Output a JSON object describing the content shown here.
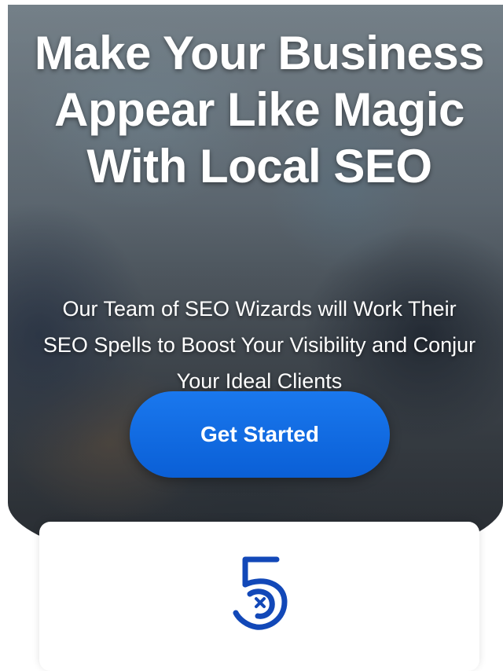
{
  "hero": {
    "headline": "Make Your Business Appear Like Magic With Local SEO",
    "subheadline": "Our Team of SEO Wizards will Work Their SEO Spells to Boost Your Visibility and Conjur Your Ideal Clients",
    "cta_label": "Get Started"
  },
  "card": {
    "logo_icon": "five-logo-icon"
  },
  "colors": {
    "cta_blue": "#0a66e4",
    "logo_blue": "#1248b8",
    "text": "#ffffff"
  }
}
